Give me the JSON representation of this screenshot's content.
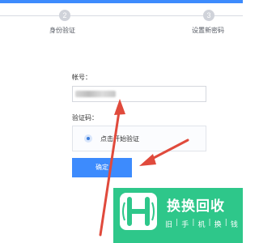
{
  "steps": [
    {
      "number": "2",
      "label": "身份验证"
    },
    {
      "number": "3",
      "label": "设置新密码"
    }
  ],
  "form": {
    "account_label": "帐号：",
    "captcha_label": "验证码：",
    "captcha_button": "点击开始验证",
    "submit_label": "确定"
  },
  "logo": {
    "title": "换换回收",
    "subtitle": [
      "旧",
      "|",
      "手",
      "|",
      "机",
      "|",
      "换",
      "|",
      "钱"
    ]
  },
  "colors": {
    "accent": "#3d8bfd",
    "annotation": "#e04a3c",
    "logo_green": "#2ec78a"
  },
  "icons": {
    "captcha": "radio-dot-icon",
    "logo": "h-logo-icon",
    "annotations": "red-arrow-icon"
  }
}
